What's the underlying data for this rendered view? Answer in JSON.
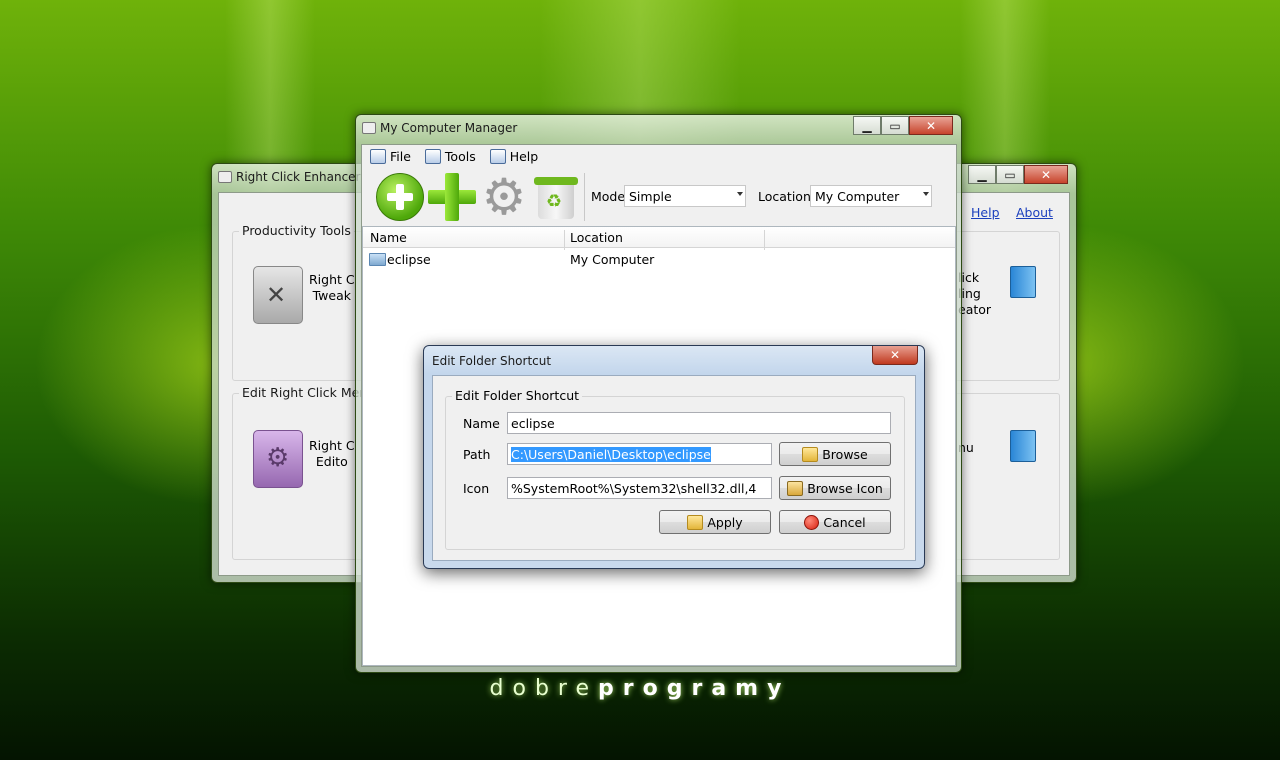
{
  "brand": {
    "light": "dobre",
    "bold": "programy"
  },
  "rce": {
    "title": "Right Click Enhancer",
    "help_link": "Help",
    "about_link": "About",
    "groups": [
      {
        "label": "Productivity Tools",
        "item_line1": "Right C",
        "item_line2": "Tweak"
      },
      {
        "label": "Edit Right Click Menu",
        "item_line1": "Right C",
        "item_line2": "Edito"
      }
    ],
    "right_items": [
      {
        "line1": "lick",
        "line2": "ling",
        "line3": "eator"
      },
      {
        "line1": "nu"
      }
    ]
  },
  "manager": {
    "title": "My Computer Manager",
    "menu": [
      "File",
      "Tools",
      "Help"
    ],
    "mode_label": "Mode",
    "mode_value": "Simple",
    "location_label": "Location",
    "location_value": "My Computer",
    "columns": [
      "Name",
      "Location"
    ],
    "rows": [
      {
        "name": "eclipse",
        "location": "My Computer"
      }
    ]
  },
  "dialog": {
    "title": "Edit Folder Shortcut",
    "group_label": "Edit Folder Shortcut",
    "name_label": "Name",
    "name_value": "eclipse",
    "path_label": "Path",
    "path_value": "C:\\Users\\Daniel\\Desktop\\eclipse",
    "icon_label": "Icon",
    "icon_value": "%SystemRoot%\\System32\\shell32.dll,4",
    "browse_label": "Browse",
    "browse_icon_label": "Browse Icon",
    "apply_label": "Apply",
    "cancel_label": "Cancel",
    "close_glyph": "✕"
  },
  "colors": {
    "accent_green": "#6fc21a",
    "selection": "#3399ff",
    "link": "#1b3fbd"
  }
}
